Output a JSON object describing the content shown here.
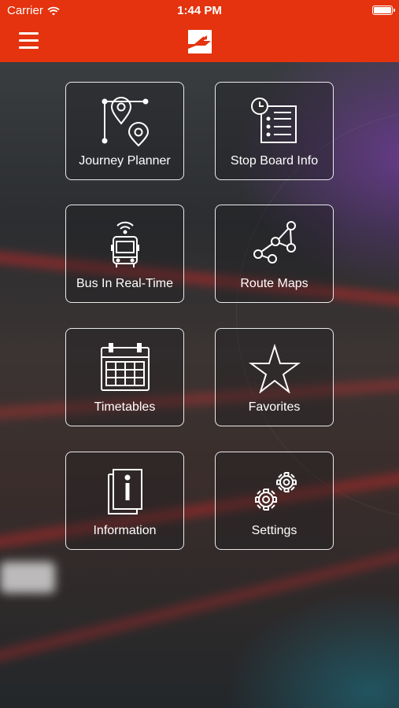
{
  "status_bar": {
    "carrier": "Carrier",
    "time": "1:44 PM"
  },
  "nav": {
    "menu_icon": "hamburger-menu-icon",
    "logo_icon": "app-logo"
  },
  "colors": {
    "brand": "#e4330e",
    "tile_border": "#ffffff"
  },
  "tiles": [
    {
      "label": "Journey Planner",
      "icon": "route-pins-icon"
    },
    {
      "label": "Stop Board Info",
      "icon": "clock-list-icon"
    },
    {
      "label": "Bus In Real-Time",
      "icon": "bus-wifi-icon"
    },
    {
      "label": "Route Maps",
      "icon": "share-nodes-icon"
    },
    {
      "label": "Timetables",
      "icon": "calendar-icon"
    },
    {
      "label": "Favorites",
      "icon": "star-icon"
    },
    {
      "label": "Information",
      "icon": "info-document-icon"
    },
    {
      "label": "Settings",
      "icon": "gears-icon"
    }
  ]
}
